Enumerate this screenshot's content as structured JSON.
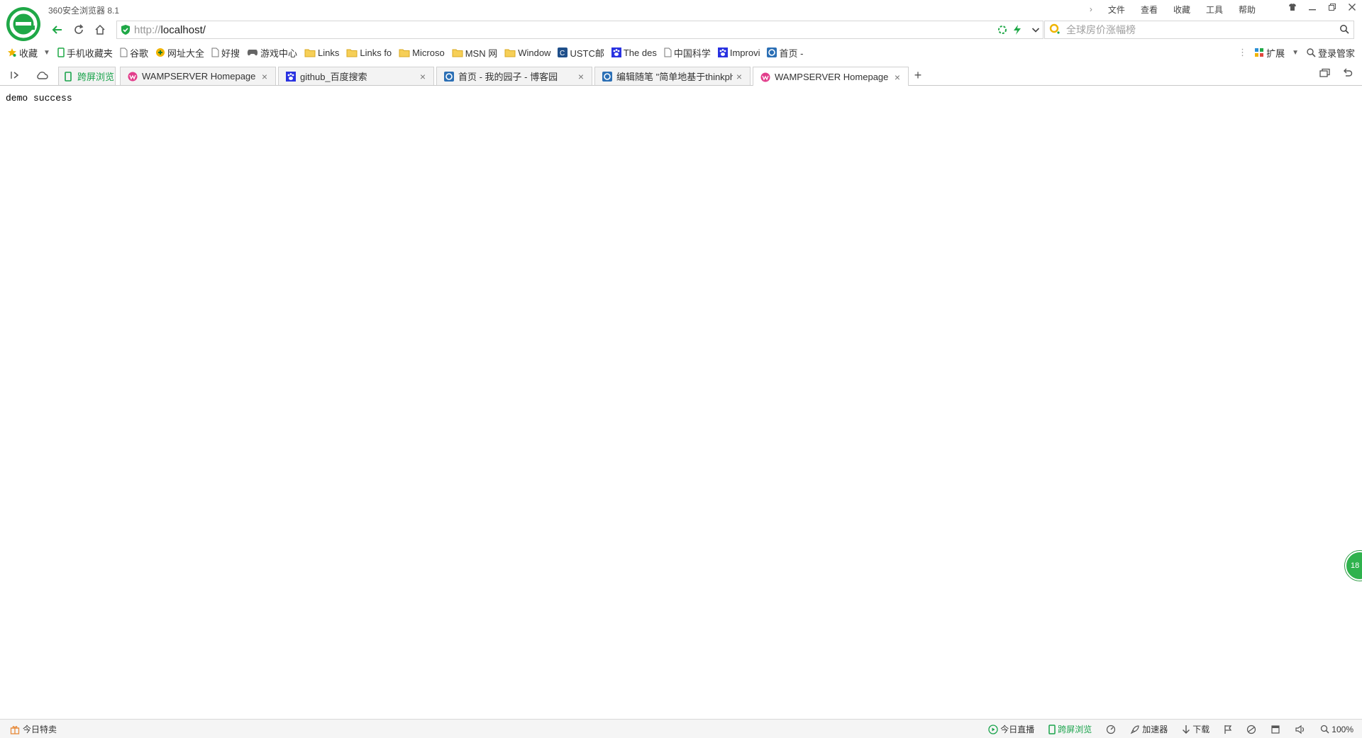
{
  "app": {
    "title": "360安全浏览器 8.1"
  },
  "menu": {
    "items": [
      "文件",
      "查看",
      "收藏",
      "工具",
      "帮助"
    ]
  },
  "address": {
    "protocol": "http://",
    "host": "localhost/"
  },
  "search": {
    "placeholder": "全球房价涨幅榜"
  },
  "bookmarks": {
    "favorites_label": "收藏",
    "items": [
      "手机收藏夹",
      "谷歌",
      "网址大全",
      "好搜",
      "游戏中心",
      "Links",
      "Links fo",
      "Microso",
      "MSN 网",
      "Window",
      "USTC邮",
      "The des",
      "中国科学",
      "Improvi",
      "首页 -"
    ],
    "extensions_label": "扩展",
    "login_label": "登录管家"
  },
  "tabs": {
    "special_label": "跨屏浏览",
    "items": [
      {
        "title": "WAMPSERVER Homepage"
      },
      {
        "title": "github_百度搜索"
      },
      {
        "title": "首页 - 我的园子 - 博客园"
      },
      {
        "title": "编辑随笔 \"简单地基于thinkphp"
      },
      {
        "title": "WAMPSERVER Homepage"
      }
    ]
  },
  "page": {
    "body_text": "demo success"
  },
  "float_ball": {
    "label": "18"
  },
  "status": {
    "left_label": "今日特卖",
    "live_label": "今日直播",
    "cross_screen_label": "跨屏浏览",
    "accelerator_label": "加速器",
    "download_label": "下载",
    "zoom": "100%"
  },
  "colors": {
    "brand_green": "#19a34b",
    "wamp_pink": "#e23d8b",
    "baidu_blue": "#2932e1"
  }
}
